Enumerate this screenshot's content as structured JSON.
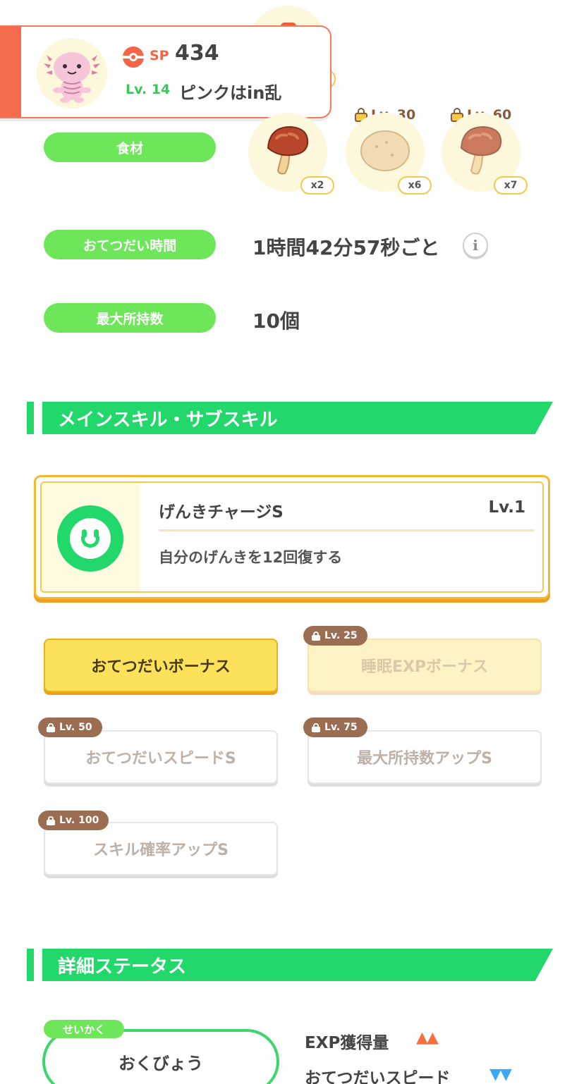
{
  "header": {
    "sp_label": "SP",
    "sp_value": "434",
    "level_label": "Lv. 14",
    "pokemon_name": "ピンクはin乱"
  },
  "ingredients": {
    "label": "食材",
    "items": [
      {
        "name": "mushroom",
        "count": "x2",
        "locked": false
      },
      {
        "name": "potato",
        "count": "x6",
        "locked": true,
        "unlock_level": "Lv. 30"
      },
      {
        "name": "mushroom",
        "count": "x7",
        "locked": true,
        "unlock_level": "Lv. 60"
      }
    ]
  },
  "help_time": {
    "label": "おてつだい時間",
    "value": "1時間42分57秒ごと",
    "info_glyph": "i"
  },
  "max_carry": {
    "label": "最大所持数",
    "value": "10個"
  },
  "skills_section": {
    "title": "メインスキル・サブスキル",
    "main_skill": {
      "name": "げんきチャージS",
      "level": "Lv.1",
      "description": "自分のげんきを12回復する"
    },
    "sub_skills": [
      {
        "label": "おてつだいボーナス",
        "lock": "",
        "state": "active"
      },
      {
        "label": "睡眠EXPボーナス",
        "lock": "Lv. 25",
        "state": "locked"
      },
      {
        "label": "おてつだいスピードS",
        "lock": "Lv. 50",
        "state": "locked"
      },
      {
        "label": "最大所持数アップS",
        "lock": "Lv. 75",
        "state": "locked"
      },
      {
        "label": "スキル確率アップS",
        "lock": "Lv. 100",
        "state": "locked"
      }
    ]
  },
  "details_section": {
    "title": "詳細ステータス",
    "nature_tag": "せいかく",
    "nature_value": "おくびょう",
    "effects": [
      {
        "label": "EXP獲得量",
        "arrows": "▲▲",
        "direction": "up"
      },
      {
        "label": "おてつだいスピード",
        "arrows": "▼▼",
        "direction": "down"
      }
    ]
  },
  "colors": {
    "accent_green": "#22d86a",
    "pill_green": "#6ee65a",
    "sp_red": "#f26545",
    "gold_border": "#f5b92e"
  }
}
